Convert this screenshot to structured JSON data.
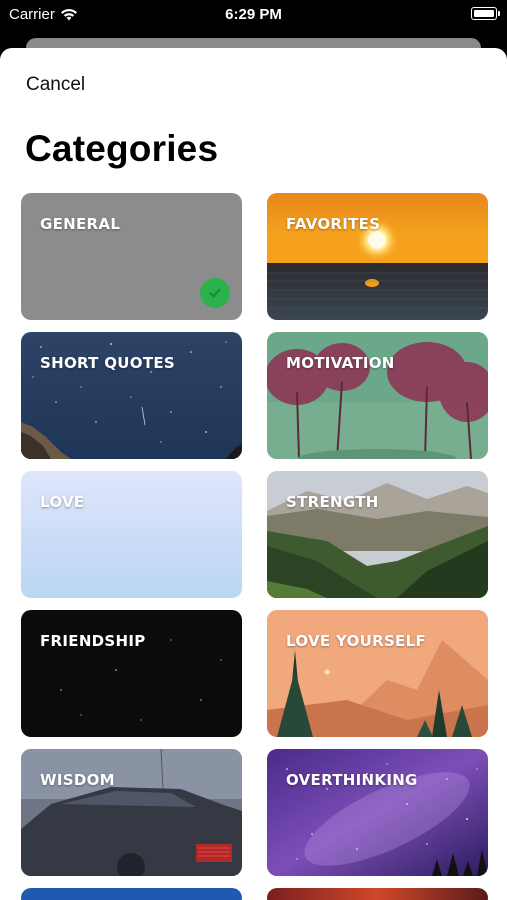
{
  "status_bar": {
    "carrier": "Carrier",
    "time": "6:29 PM",
    "icons": [
      "wifi-icon",
      "battery-icon"
    ]
  },
  "sheet": {
    "cancel_label": "Cancel",
    "title": "Categories"
  },
  "categories": [
    {
      "label": "GENERAL",
      "selected": true,
      "icon": "checkmark-icon",
      "accent": "#2bb24c"
    },
    {
      "label": "FAVORITES",
      "selected": false
    },
    {
      "label": "SHORT QUOTES",
      "selected": false
    },
    {
      "label": "MOTIVATION",
      "selected": false
    },
    {
      "label": "LOVE",
      "selected": false
    },
    {
      "label": "STRENGTH",
      "selected": false
    },
    {
      "label": "FRIENDSHIP",
      "selected": false
    },
    {
      "label": "LOVE YOURSELF",
      "selected": false
    },
    {
      "label": "WISDOM",
      "selected": false
    },
    {
      "label": "OVERTHINKING",
      "selected": false
    }
  ]
}
